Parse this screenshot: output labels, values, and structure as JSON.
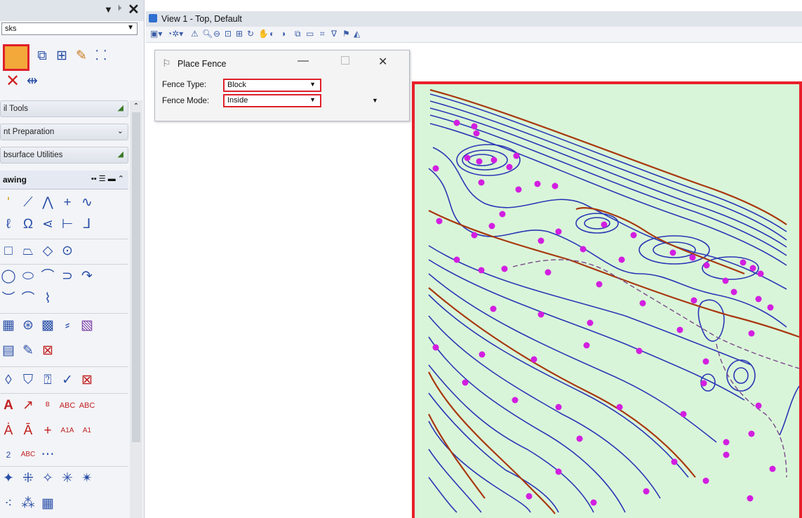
{
  "left_panel": {
    "task_select": "sks",
    "sections": [
      {
        "label": "il Tools"
      },
      {
        "label": "nt Preparation"
      },
      {
        "label": "bsurface Utilities"
      }
    ],
    "drawing_header": "awing"
  },
  "view": {
    "title": "View 1 - Top, Default"
  },
  "place_fence": {
    "title": "Place Fence",
    "fence_type_label": "Fence Type:",
    "fence_type_value": "Block",
    "fence_mode_label": "Fence Mode:",
    "fence_mode_value": "Inside"
  },
  "colors": {
    "highlight": "#e0202a",
    "map_bg": "#d9f5d9",
    "contour_blue": "#2a37b5",
    "contour_brown": "#a8380e",
    "points": "#d21ee0"
  }
}
